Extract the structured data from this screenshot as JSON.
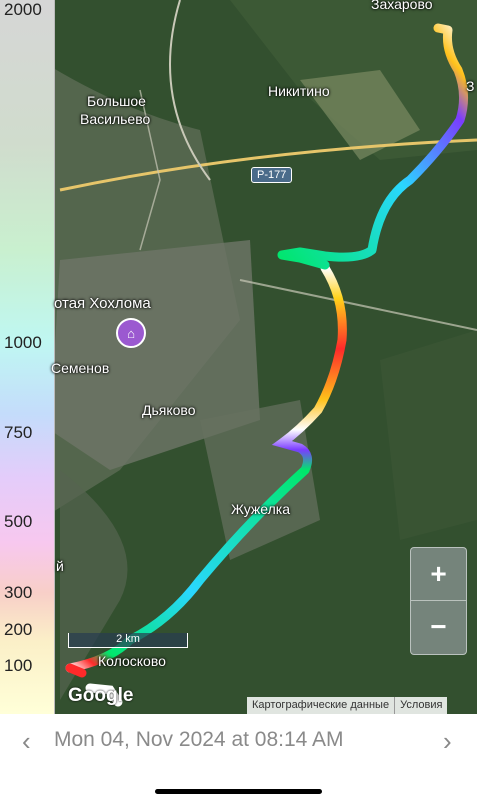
{
  "altitude_scale": {
    "ticks": [
      "2000",
      "1000",
      "750",
      "500",
      "300",
      "200",
      "100"
    ]
  },
  "map": {
    "labels": {
      "zakharovo": "Захарово",
      "z": "З",
      "bolshoe": "Большое",
      "vasilevo": "Васильево",
      "nikitino": "Никитино",
      "road": "Р-177",
      "khokhloma": "отая Хохлома",
      "semenov": "Семенов",
      "dyakovo": "Дьяково",
      "zhuzhelka": "Жужелка",
      "koloskovo": "Колосково",
      "ey": "й"
    },
    "scale_label": "2 km",
    "google_logo": "Google",
    "attribution": {
      "data": "Картографические данные",
      "terms": "Условия"
    },
    "zoom_in": "+",
    "zoom_out": "−"
  },
  "footer": {
    "date": "Mon 04, Nov 2024 at 08:14 AM",
    "prev": "‹",
    "next": "›"
  },
  "colors": {
    "track_low": "#ff2a2a",
    "track_mid": "#00e66b",
    "track_high": "#2ad7ff",
    "accent": "#8a8a8a"
  }
}
